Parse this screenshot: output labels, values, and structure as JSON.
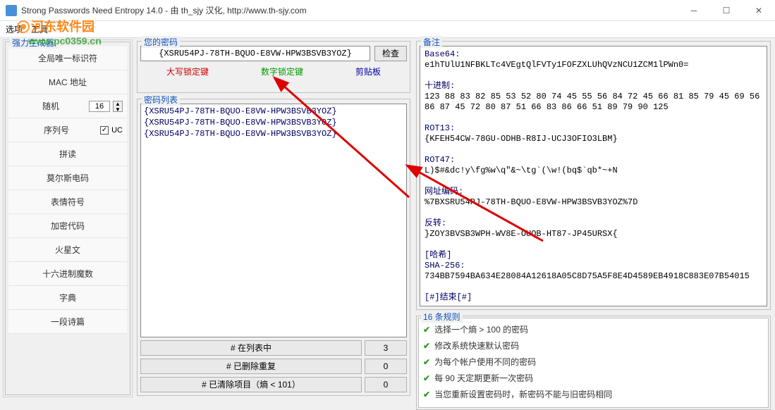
{
  "window": {
    "title": "Strong Passwords Need Entropy 14.0 - 由 th_sjy 汉化, http://www.th-sjy.com"
  },
  "menu": {
    "options": "选项",
    "tools": "工具"
  },
  "watermarks": {
    "w1": "河东软件园",
    "w2": "www.pc0359.cn"
  },
  "sidebar": {
    "group": "强力生成器:",
    "items": [
      "全局唯一标识符",
      "MAC 地址",
      "随机",
      "序列号",
      "拼读",
      "莫尔斯电码",
      "表情符号",
      "加密代码",
      "火星文",
      "十六进制魔数",
      "字典",
      "一段诗篇"
    ],
    "spin_value": "16",
    "uc_label": "UC"
  },
  "password_panel": {
    "group": "您的密码",
    "value": "{XSRU54PJ-78TH-BQUO-E8VW-HPW3BSVB3YOZ}",
    "check_btn": "检查",
    "caps": "大写锁定键",
    "num": "数字锁定键",
    "clip": "剪贴板"
  },
  "list_panel": {
    "group": "密码列表",
    "items": [
      "{XSRU54PJ-78TH-BQUO-E8VW-HPW3BSVB3YOZ}",
      "{XSRU54PJ-78TH-BQUO-E8VW-HPW3BSVB3YOZ}",
      "{XSRU54PJ-78TH-BQUO-E8VW-HPW3BSVB3YOZ}"
    ],
    "stats": [
      {
        "label": "# 在列表中",
        "value": "3"
      },
      {
        "label": "# 已删除重复",
        "value": "0"
      },
      {
        "label": "# 已清除项目（熵 < 101）",
        "value": "0"
      }
    ]
  },
  "remarks": {
    "group": "备注",
    "lines": [
      "Base64:",
      "e1hTUlU1NFBKLTc4VEgtQlFVTy1FOFZXLUhQVzNCU1ZCM1lPWn0=",
      "",
      "十进制:",
      "123 88 83 82 85 53 52 80 74 45 55 56 84 72 45 66 81 85 79 45 69 56 86 87 45 72 80 87 51 66 83 86 66 51 89 79 90 125",
      "",
      "ROT13:",
      "{KFEH54CW-78GU-ODHB-R8IJ-UCJ3OFIO3LBM}",
      "",
      "ROT47:",
      "L)$#&dc!y\\fg%w\\q\"&~\\tg`(\\w!(bq$`qb*~+N",
      "",
      "网址编码:",
      "%7BXSRU54PJ-78TH-BQUO-E8VW-HPW3BSVB3YOZ%7D",
      "",
      "反转:",
      "}ZOY3BVSB3WPH-WV8E-OUQB-HT87-JP45URSX{",
      "",
      "[哈希]",
      "SHA-256:",
      "734BB7594BA634E28084A12618A05C8D75A5F8E4D4589EB4918C883E07B54015",
      "",
      "[#]结束[#]"
    ]
  },
  "rules": {
    "group": "16 条规则",
    "items": [
      "选择一个熵 > 100 的密码",
      "修改系统快速默认密码",
      "为每个帐户使用不同的密码",
      "每 90 天定期更新一次密码",
      "当您重新设置密码时，新密码不能与旧密码相同"
    ]
  }
}
